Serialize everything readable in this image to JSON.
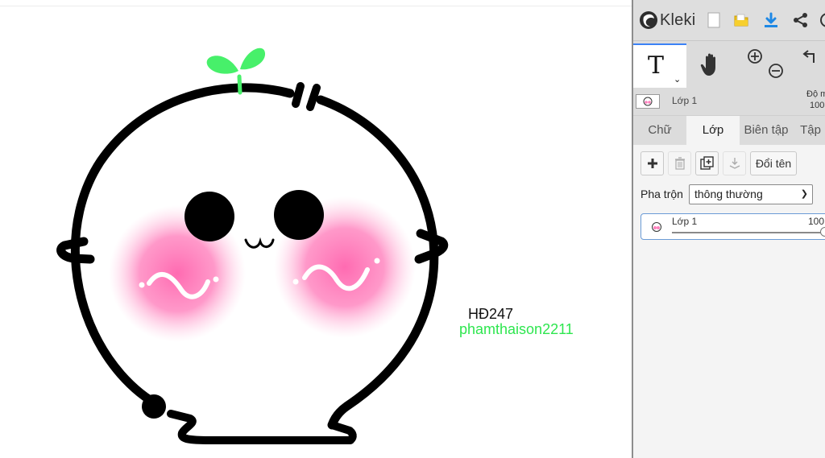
{
  "canvas": {
    "text_code": "HĐ247",
    "text_credit": "phamthaison2211",
    "credit_color": "#2ee64f",
    "leaf_color": "#47f06a",
    "blush_color": "#ff6fb0"
  },
  "app": {
    "name": "Kleki"
  },
  "topbar": {
    "icons": [
      "new-file-icon",
      "open-folder-icon",
      "download-icon",
      "share-icon",
      "help-icon"
    ],
    "download_color": "#1e88e5",
    "folder_color": "#f0c419"
  },
  "toolbar": {
    "text_tool_glyph": "T",
    "icons": [
      "text-tool-icon",
      "hand-tool-icon",
      "zoom-in-icon",
      "zoom-out-icon",
      "undo-icon"
    ]
  },
  "layer_bar": {
    "layer_name": "Lớp 1",
    "opacity_label": "Độ m",
    "opacity_value": "100"
  },
  "tabs": [
    "Chữ",
    "Lớp",
    "Biên tập",
    "Tập"
  ],
  "active_tab": "Lớp",
  "layers_panel": {
    "rename_label": "Đổi tên",
    "blend_label": "Pha trộn",
    "blend_value": "thông thường",
    "layers": [
      {
        "name": "Lớp 1",
        "opacity": "100"
      }
    ]
  }
}
